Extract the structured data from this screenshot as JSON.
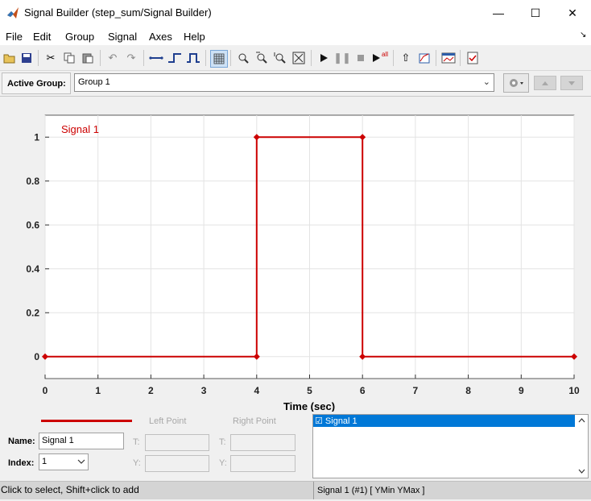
{
  "window": {
    "title": "Signal Builder (step_sum/Signal Builder)",
    "minimize_glyph": "—",
    "maximize_glyph": "☐",
    "close_glyph": "✕"
  },
  "menu": {
    "items": [
      "File",
      "Edit",
      "Group",
      "Signal",
      "Axes",
      "Help"
    ],
    "overflow_glyph": "↘"
  },
  "toolbar": {
    "icons": [
      "open-folder-icon",
      "save-icon",
      "cut-icon",
      "copy-icon",
      "paste-icon",
      "undo-icon",
      "redo-icon",
      "constant-icon",
      "step-icon",
      "pulse-icon",
      "grid-toggle-icon",
      "zoom-xy-icon",
      "zoom-x-icon",
      "zoom-y-icon",
      "fit-icon",
      "start-icon",
      "pause-icon",
      "stop-icon",
      "run-all-icon",
      "go-to-block-icon",
      "show-signal-icon",
      "verification-icon",
      "requirements-icon"
    ],
    "run_all_label": "all"
  },
  "group": {
    "label": "Active Group:",
    "value": "Group 1",
    "arrow": "⌄"
  },
  "chart_data": {
    "type": "line",
    "title": "",
    "xlabel": "Time (sec)",
    "ylabel": "",
    "xlim": [
      0,
      10
    ],
    "ylim": [
      -0.1,
      1.1
    ],
    "xticks": [
      0,
      1,
      2,
      3,
      4,
      5,
      6,
      7,
      8,
      9,
      10
    ],
    "yticks": [
      0,
      0.2,
      0.4,
      0.6,
      0.8,
      1
    ],
    "ytick_labels": [
      "0",
      "0.2",
      "0.4",
      "0.6",
      "0.8",
      "1"
    ],
    "grid": true,
    "series": [
      {
        "name": "Signal 1",
        "color": "#cc0000",
        "x": [
          0,
          4,
          4,
          6,
          6,
          10
        ],
        "y": [
          0,
          0,
          1,
          1,
          0,
          0
        ]
      }
    ]
  },
  "bottom": {
    "left_point_label": "Left Point",
    "right_point_label": "Right Point",
    "name_label": "Name:",
    "name_value": "Signal 1",
    "index_label": "Index:",
    "index_value": "1",
    "t_label": "T:",
    "y_label": "Y:",
    "list_items": [
      "☑ Signal 1"
    ]
  },
  "status": {
    "left": "Click to select, Shift+click to add",
    "right": "Signal 1 (#1)  [ YMin YMax ]"
  }
}
